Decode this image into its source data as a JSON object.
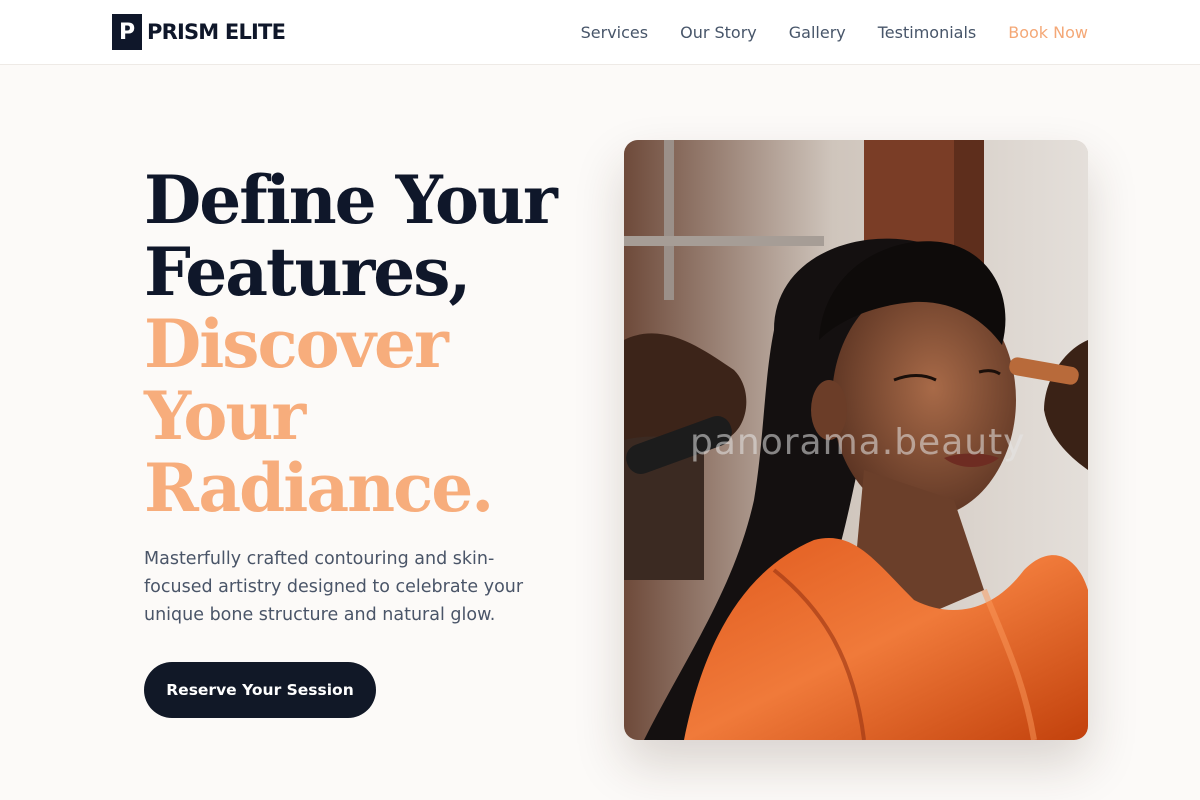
{
  "brand": {
    "mark": "P",
    "name": "PRISM ELITE"
  },
  "nav": {
    "items": [
      "Services",
      "Our Story",
      "Gallery",
      "Testimonials"
    ],
    "cta": "Book Now"
  },
  "hero": {
    "headline_line1": "Define Your",
    "headline_line2": "Features,",
    "headline_accent1": "Discover",
    "headline_accent2": "Your",
    "headline_accent3": "Radiance.",
    "subtitle": "Masterfully crafted contouring and skin-focused artistry designed to celebrate your unique bone structure and natural glow.",
    "button": "Reserve Your Session"
  },
  "image": {
    "watermark": "panorama.beauty"
  },
  "colors": {
    "primary": "#0f172a",
    "accent": "#f7ad7c",
    "background": "#fcfaf8"
  }
}
